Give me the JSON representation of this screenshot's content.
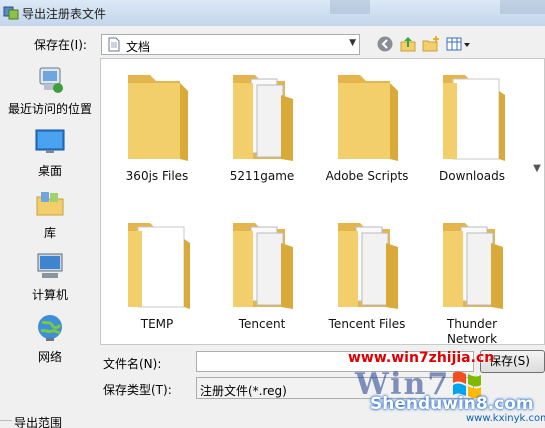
{
  "window": {
    "title": "导出注册表文件"
  },
  "lookin": {
    "label": "保存在(I):",
    "value": "文档"
  },
  "places": [
    {
      "label": "最近访问的位置",
      "icon": "recent-places-icon"
    },
    {
      "label": "桌面",
      "icon": "desktop-icon"
    },
    {
      "label": "库",
      "icon": "libraries-icon"
    },
    {
      "label": "计算机",
      "icon": "computer-icon"
    },
    {
      "label": "网络",
      "icon": "network-icon"
    }
  ],
  "files": [
    {
      "name": "360js Files",
      "variant": "plain"
    },
    {
      "name": "5211game",
      "variant": "docs"
    },
    {
      "name": "Adobe Scripts",
      "variant": "plain"
    },
    {
      "name": "Downloads",
      "variant": "paper"
    },
    {
      "name": "TEMP",
      "variant": "paper"
    },
    {
      "name": "Tencent",
      "variant": "docs"
    },
    {
      "name": "Tencent Files",
      "variant": "docs"
    },
    {
      "name": "Thunder Network",
      "variant": "docs"
    }
  ],
  "form": {
    "filename_label": "文件名(N):",
    "filename_value": "",
    "type_label": "保存类型(T):",
    "type_value": "注册文件(*.reg)",
    "save_label": "保存(S)",
    "export_range_label": "导出范围"
  },
  "watermark": {
    "url": "www.win7zhijia.cn",
    "big_text": "Win7",
    "site": "Shenduwin8.com",
    "sub": "www.kxinyk.com"
  },
  "colors": {
    "folder": "#f2cf6b",
    "folder_dark": "#d9a93a",
    "accent": "#1763c9"
  }
}
